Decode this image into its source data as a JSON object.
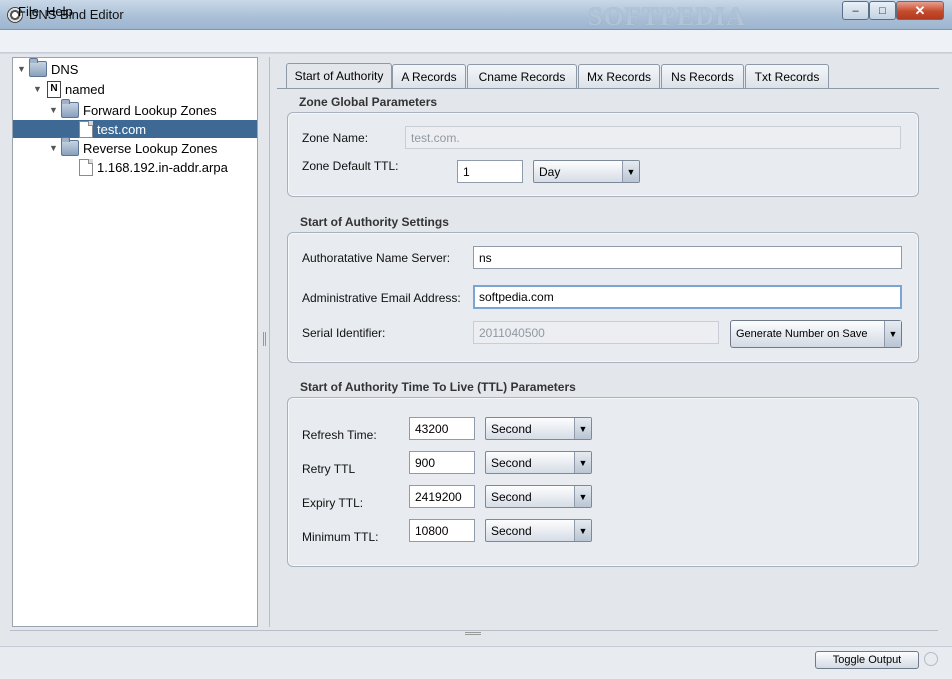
{
  "window": {
    "title": "DNS Bind Editor",
    "watermark": "SOFTPEDIA",
    "controls": {
      "minimize": "–",
      "maximize": "□",
      "close": "✕"
    }
  },
  "menu": {
    "file": "File",
    "help": "Help"
  },
  "tree": {
    "root": "DNS",
    "named": "named",
    "forward": "Forward Lookup Zones",
    "forward_child": "test.com",
    "reverse": "Reverse Lookup Zones",
    "reverse_child": "1.168.192.in-addr.arpa",
    "expand_glyph": "▼"
  },
  "tabs": [
    "Start of Authority",
    "A Records",
    "Cname Records",
    "Mx Records",
    "Ns Records",
    "Txt Records"
  ],
  "zone_global": {
    "title": "Zone Global Parameters",
    "zone_name_label": "Zone Name:",
    "zone_name_value": "test.com.",
    "default_ttl_label": "Zone Default TTL:",
    "default_ttl_value": "1",
    "default_ttl_unit": "Day"
  },
  "soa_settings": {
    "title": "Start of Authority Settings",
    "ns_label": "Authoratative Name Server:",
    "ns_value": "ns",
    "email_label": "Administrative Email Address:",
    "email_value": "softpedia.com",
    "serial_label": "Serial Identifier:",
    "serial_value": "2011040500",
    "generate_button": "Generate Number on Save"
  },
  "soa_ttl": {
    "title": "Start of Authority Time To Live (TTL) Parameters",
    "rows": [
      {
        "label": "Refresh Time:",
        "value": "43200",
        "unit": "Second"
      },
      {
        "label": "Retry TTL",
        "value": "900",
        "unit": "Second"
      },
      {
        "label": "Expiry TTL:",
        "value": "2419200",
        "unit": "Second"
      },
      {
        "label": "Minimum TTL:",
        "value": "10800",
        "unit": "Second"
      }
    ]
  },
  "footer": {
    "toggle_output": "Toggle Output"
  }
}
